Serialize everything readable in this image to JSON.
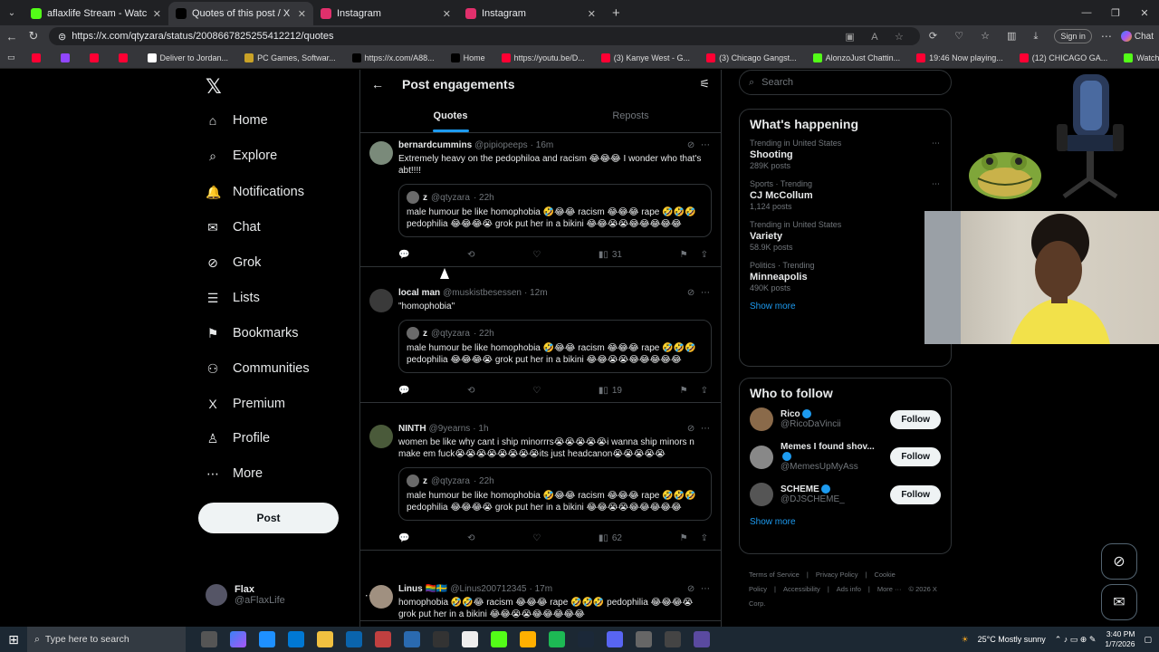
{
  "browser": {
    "tabs": [
      {
        "title": "aflaxlife Stream - Watch Live on Kick",
        "color": "#53fc18",
        "active": false
      },
      {
        "title": "Quotes of this post / X",
        "color": "#000000",
        "active": true
      },
      {
        "title": "Instagram",
        "color": "#e1306c",
        "active": false
      },
      {
        "title": "Instagram",
        "color": "#e1306c",
        "active": false
      }
    ],
    "url": "https://x.com/qtyzara/status/2008667825255412212/quotes",
    "signin": "Sign in",
    "chat": "Chat",
    "bookmarks": [
      {
        "label": "",
        "color": "#ff0033"
      },
      {
        "label": "",
        "color": "#9146ff"
      },
      {
        "label": "",
        "color": "#ff0033"
      },
      {
        "label": "",
        "color": "#ff0033"
      },
      {
        "label": "Deliver to Jordan...",
        "color": "#ffffff"
      },
      {
        "label": "PC Games, Softwar...",
        "color": "#c9a227"
      },
      {
        "label": "https://x.com/A88...",
        "color": "#000000"
      },
      {
        "label": "Home",
        "color": "#000000"
      },
      {
        "label": "https://youtu.be/D...",
        "color": "#ff0033"
      },
      {
        "label": "(3) Kanye West - G...",
        "color": "#ff0033"
      },
      {
        "label": "(3) Chicago Gangst...",
        "color": "#ff0033"
      },
      {
        "label": "AlonzoJust Chattin...",
        "color": "#53fc18"
      },
      {
        "label": "19:46 Now playing...",
        "color": "#ff0033"
      },
      {
        "label": "(12) CHICAGO GA...",
        "color": "#ff0033"
      },
      {
        "label": "Watch now",
        "color": "#53fc18"
      }
    ]
  },
  "nav": {
    "items": [
      {
        "label": "Home",
        "icon": "⌂"
      },
      {
        "label": "Explore",
        "icon": "⌕"
      },
      {
        "label": "Notifications",
        "icon": "🔔"
      },
      {
        "label": "Chat",
        "icon": "✉"
      },
      {
        "label": "Grok",
        "icon": "⊘"
      },
      {
        "label": "Lists",
        "icon": "☰"
      },
      {
        "label": "Bookmarks",
        "icon": "⚑"
      },
      {
        "label": "Communities",
        "icon": "⚇"
      },
      {
        "label": "Premium",
        "icon": "X"
      },
      {
        "label": "Profile",
        "icon": "♙"
      },
      {
        "label": "More",
        "icon": "⋯"
      }
    ],
    "post": "Post",
    "account": {
      "name": "Flax",
      "handle": "@aFlaxLife"
    }
  },
  "main": {
    "title": "Post engagements",
    "tabs": [
      "Quotes",
      "Reposts"
    ],
    "tweets": [
      {
        "name": "bernardcummins",
        "handle": "@pipiopeeps",
        "time": "· 16m",
        "text": "Extremely heavy on the pedophiloa and racism 😂😂😂 I wonder who that's abt!!!!",
        "views": "31",
        "avatar": "#7a8a7a",
        "quote": {
          "name": "z",
          "handle": "@qtyzara",
          "time": "· 22h",
          "text": "male humour be like homophobia 🤣😂😂 racism 😂😂😂 rape 🤣🤣🤣 pedophilia 😂😂😂😭 grok put her in a bikini 😂😂😭😭😂😂😂😂😂"
        }
      },
      {
        "name": "local man",
        "handle": "@muskistbesessen",
        "time": "· 12m",
        "text": "\"homophobia\"",
        "views": "19",
        "avatar": "#3a3a3a",
        "quote": {
          "name": "z",
          "handle": "@qtyzara",
          "time": "· 22h",
          "text": "male humour be like homophobia 🤣😂😂 racism 😂😂😂 rape 🤣🤣🤣 pedophilia 😂😂😂😭 grok put her in a bikini 😂😂😭😭😂😂😂😂😂"
        }
      },
      {
        "name": "NINTH",
        "handle": "@9yearns",
        "time": "· 1h",
        "text": "women be like why cant i ship minorrrs😭😭😭😭😭i wanna ship minors n make em fuck😭😭😭😭😭😭😭😭its just headcanon😭😭😭😭😭",
        "views": "62",
        "avatar": "#4a5a3a",
        "quote": {
          "name": "z",
          "handle": "@qtyzara",
          "time": "· 22h",
          "text": "male humour be like homophobia 🤣😂😂 racism 😂😂😂 rape 🤣🤣🤣 pedophilia 😂😂😂😭 grok put her in a bikini 😂😂😭😭😂😂😂😂😂"
        }
      },
      {
        "name": "Linus 🏳️‍🌈🇸🇪",
        "handle": "@Linus200712345",
        "time": "· 17m",
        "text": "homophobia 🤣🤣😂 racism 😂😂😂 rape 🤣🤣🤣 pedophilia 😂😂😂😭 grok put her in a bikini 😂😂😭😭😂😂😂😂😂",
        "views": "",
        "avatar": "#a09080",
        "quote": null
      }
    ]
  },
  "right": {
    "search_placeholder": "Search",
    "happening_title": "What's happening",
    "trends": [
      {
        "cat": "Trending in United States",
        "name": "Shooting",
        "count": "289K posts"
      },
      {
        "cat": "Sports · Trending",
        "name": "CJ McCollum",
        "count": "1,124 posts"
      },
      {
        "cat": "Trending in United States",
        "name": "Variety",
        "count": "58.9K posts"
      },
      {
        "cat": "Politics · Trending",
        "name": "Minneapolis",
        "count": "490K posts"
      }
    ],
    "show_more": "Show more",
    "wtf_title": "Who to follow",
    "follow": [
      {
        "name": "Rico",
        "handle": "@RicoDaVincii",
        "btn": "Follow",
        "avatar": "#8a6a4a"
      },
      {
        "name": "Memes I found shov...",
        "handle": "@MemesUpMyAss",
        "btn": "Follow",
        "avatar": "#888"
      },
      {
        "name": "SCHEME",
        "handle": "@DJSCHEME_",
        "btn": "Follow",
        "avatar": "#555"
      }
    ],
    "show_more2": "Show more",
    "footer": [
      "Terms of Service",
      "|",
      "Privacy Policy",
      "|",
      "Cookie Policy",
      "|",
      "Accessibility",
      "|",
      "Ads info",
      "|",
      "More ···",
      "© 2026 X Corp."
    ]
  },
  "taskbar": {
    "search": "Type here to search",
    "weather": "25°C  Mostly sunny",
    "time": "3:40 PM",
    "date": "1/7/2026"
  }
}
